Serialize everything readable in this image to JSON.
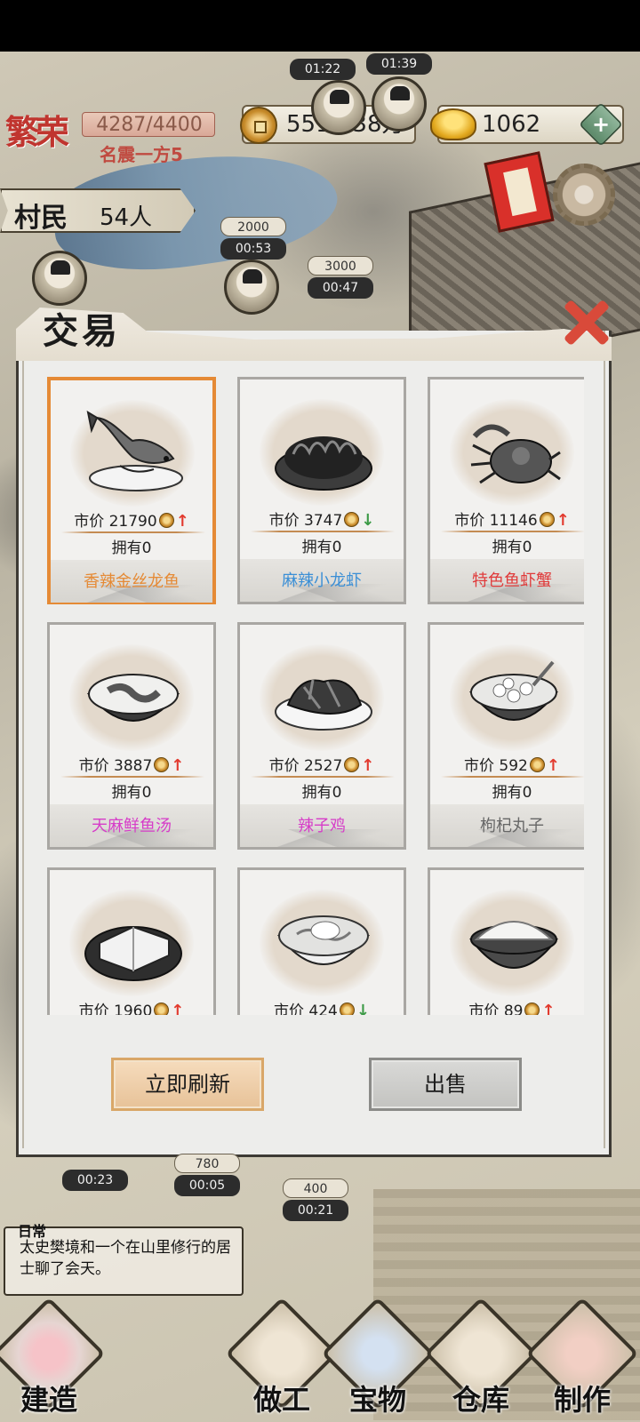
{
  "hud": {
    "prosperity_title": "繁荣",
    "prosperity_value": "4287/4400",
    "rank_label": "名震一方5",
    "coins": "5513.38万",
    "gold": "1062",
    "plus_label": "+",
    "villager_label": "村民",
    "villager_count": "54人"
  },
  "map_tags": {
    "timer_1": "01:22",
    "timer_2": "01:39",
    "reward_1": "2000",
    "timer_3": "00:53",
    "reward_2": "3000",
    "timer_4": "00:47",
    "reward_3": "780",
    "timer_5": "00:05",
    "timer_6": "00:23",
    "reward_4": "400",
    "timer_7": "00:21"
  },
  "modal": {
    "title": "交易",
    "price_label": "市价",
    "owned_label": "拥有",
    "items": [
      {
        "name": "香辣金丝龙鱼",
        "price": "21790",
        "trend": "up",
        "owned": "0",
        "name_color": "#e58a35"
      },
      {
        "name": "麻辣小龙虾",
        "price": "3747",
        "trend": "down",
        "owned": "0",
        "name_color": "#3b8fd6"
      },
      {
        "name": "特色鱼虾蟹",
        "price": "11146",
        "trend": "up",
        "owned": "0",
        "name_color": "#e03a3a"
      },
      {
        "name": "天麻鲜鱼汤",
        "price": "3887",
        "trend": "up",
        "owned": "0",
        "name_color": "#d63cc8"
      },
      {
        "name": "辣子鸡",
        "price": "2527",
        "trend": "up",
        "owned": "0",
        "name_color": "#d63cc8"
      },
      {
        "name": "枸杞丸子",
        "price": "592",
        "trend": "up",
        "owned": "0",
        "name_color": "#666666"
      },
      {
        "name": "",
        "price": "1960",
        "trend": "up",
        "owned": "",
        "name_color": "#666666"
      },
      {
        "name": "",
        "price": "424",
        "trend": "down",
        "owned": "",
        "name_color": "#666666"
      },
      {
        "name": "",
        "price": "89",
        "trend": "up",
        "owned": "",
        "name_color": "#666666"
      }
    ],
    "refresh_label": "立即刷新",
    "sell_label": "出售"
  },
  "log": {
    "label": "日常",
    "text": "太史樊境和一个在山里修行的居士聊了会天。"
  },
  "nav": {
    "build": "建造",
    "work": "做工",
    "treasure": "宝物",
    "warehouse": "仓库",
    "craft": "制作"
  },
  "colors": {
    "selected_border": "#e58a35",
    "trend_up": "#e23a2e",
    "trend_down": "#3c9a46",
    "close": "#d94a3a"
  }
}
